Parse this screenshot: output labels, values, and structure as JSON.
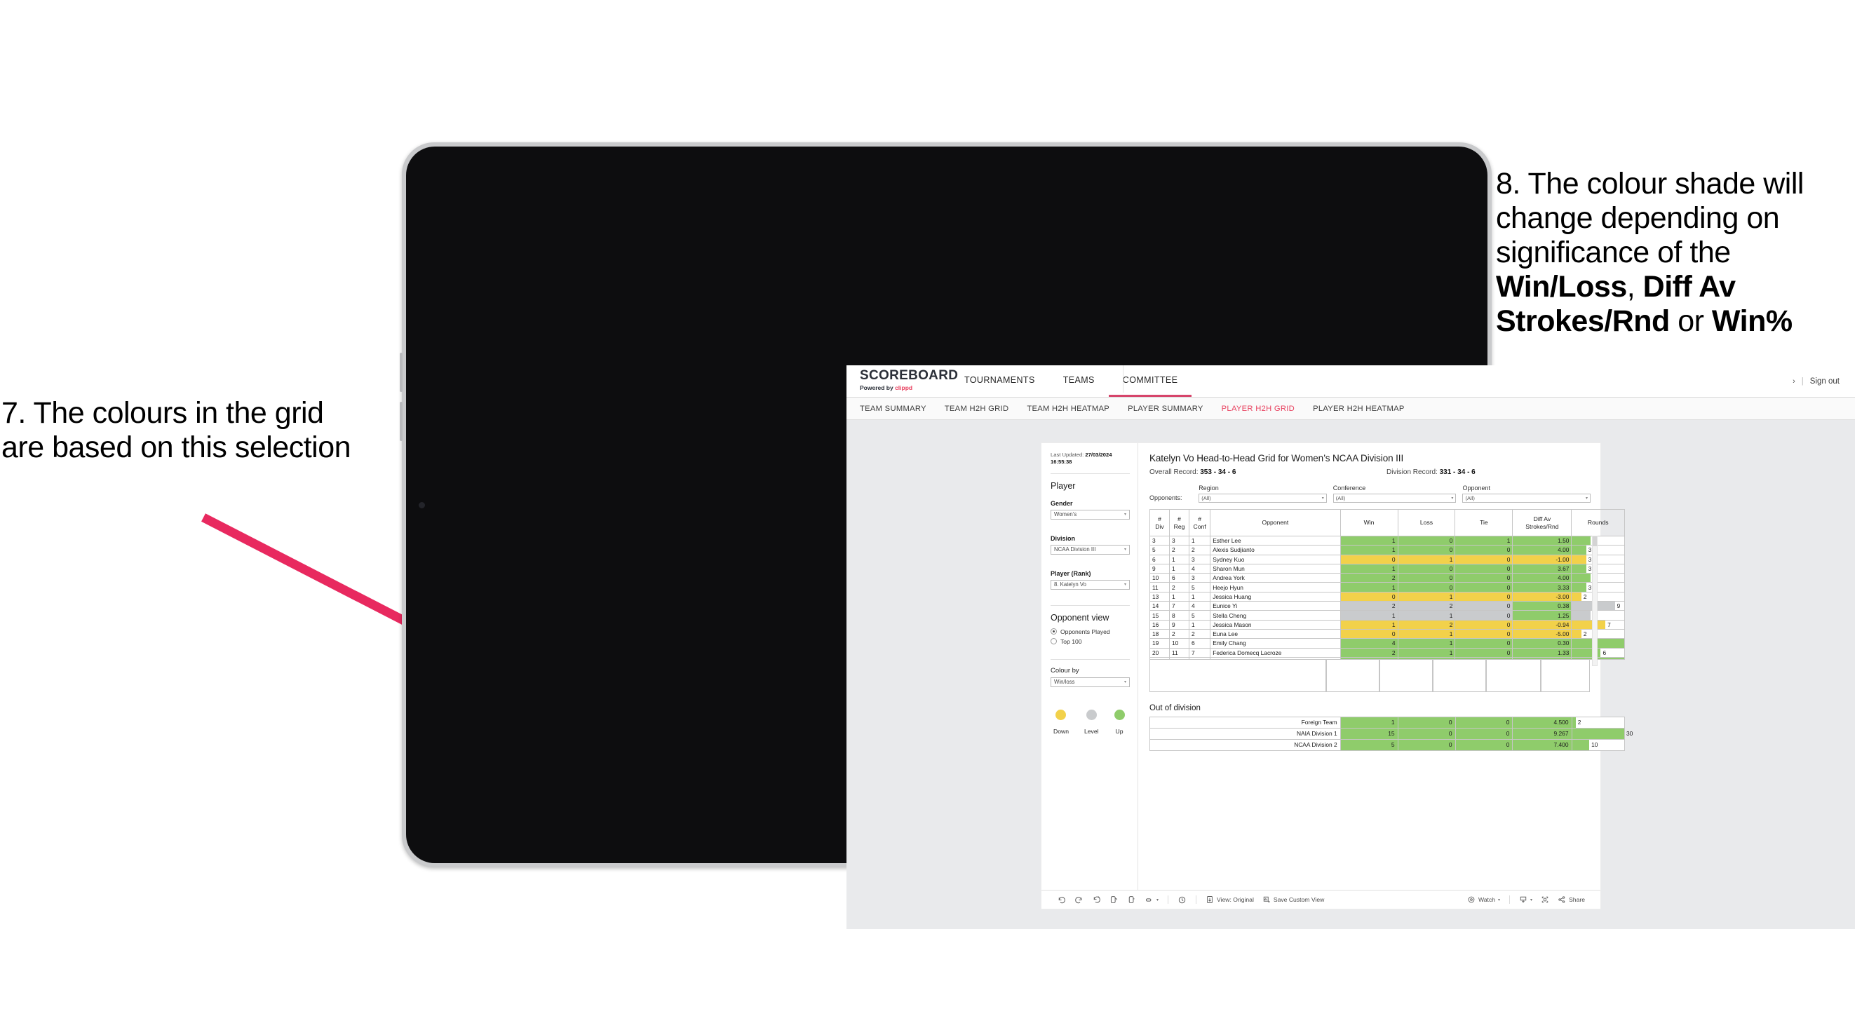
{
  "annotations": {
    "left": "7. The colours in the grid are based on this selection",
    "right_plain_1": "8. The colour shade will change depending on significance of the ",
    "right_bold_1": "Win/Loss",
    "right_sep_1": ", ",
    "right_bold_2": "Diff Av Strokes/Rnd",
    "right_plain_2": " or ",
    "right_bold_3": "Win%"
  },
  "app": {
    "logo": {
      "title": "SCOREBOARD",
      "powered_prefix": "Powered by ",
      "brand": "clippd"
    },
    "topnav": [
      {
        "label": "TOURNAMENTS",
        "active": false
      },
      {
        "label": "TEAMS",
        "active": false
      },
      {
        "label": "COMMITTEE",
        "active": true
      }
    ],
    "topnav_right": {
      "chevron": "›",
      "divider": "|",
      "signout": "Sign out"
    },
    "subnav": [
      {
        "label": "TEAM SUMMARY",
        "active": false
      },
      {
        "label": "TEAM H2H GRID",
        "active": false
      },
      {
        "label": "TEAM H2H HEATMAP",
        "active": false
      },
      {
        "label": "PLAYER SUMMARY",
        "active": false
      },
      {
        "label": "PLAYER H2H GRID",
        "active": true
      },
      {
        "label": "PLAYER H2H HEATMAP",
        "active": false
      }
    ]
  },
  "panel": {
    "last_updated_label": "Last Updated: ",
    "last_updated_value": "27/03/2024 16:55:38",
    "player_heading": "Player",
    "gender_label": "Gender",
    "gender_value": "Women’s",
    "division_label": "Division",
    "division_value": "NCAA Division III",
    "player_rank_label": "Player (Rank)",
    "player_rank_value": "8. Katelyn Vo",
    "opponent_view_heading": "Opponent view",
    "opponent_view_options": [
      {
        "label": "Opponents Played",
        "selected": true
      },
      {
        "label": "Top 100",
        "selected": false
      }
    ],
    "colour_by_label": "Colour by",
    "colour_by_value": "Win/loss",
    "legend": [
      {
        "label": "Down",
        "color": "#f2d14a"
      },
      {
        "label": "Level",
        "color": "#c9cbcd"
      },
      {
        "label": "Up",
        "color": "#8fcc6b"
      }
    ],
    "caret": "▾"
  },
  "view": {
    "title": "Katelyn Vo Head-to-Head Grid for Women’s NCAA Division III",
    "overall_record_label": "Overall Record: ",
    "overall_record_value": "353 -  34 - 6",
    "division_record_label": "Division Record: ",
    "division_record_value": "331 -  34 - 6",
    "opponents_label": "Opponents:",
    "filters": [
      {
        "label": "Region",
        "value": "(All)"
      },
      {
        "label": "Conference",
        "value": "(All)"
      },
      {
        "label": "Opponent",
        "value": "(All)"
      }
    ],
    "caret": "▾",
    "out_of_division_title": "Out of division"
  },
  "chart_data": {
    "type": "table",
    "title": "Katelyn Vo Head-to-Head Grid for Women’s NCAA Division III",
    "columns": [
      "# Div",
      "# Reg",
      "# Conf",
      "Opponent",
      "Win",
      "Loss",
      "Tie",
      "Diff Av Strokes/Rnd",
      "Rounds"
    ],
    "column_headers_multiline": [
      {
        "l1": "#",
        "l2": "Div"
      },
      {
        "l1": "#",
        "l2": "Reg"
      },
      {
        "l1": "#",
        "l2": "Conf"
      },
      {
        "l1": "Opponent",
        "l2": ""
      },
      {
        "l1": "Win",
        "l2": ""
      },
      {
        "l1": "Loss",
        "l2": ""
      },
      {
        "l1": "Tie",
        "l2": ""
      },
      {
        "l1": "Diff Av",
        "l2": "Strokes/Rnd"
      },
      {
        "l1": "Rounds",
        "l2": ""
      }
    ],
    "rounds_max": 11,
    "rows": [
      {
        "div": "3",
        "reg": "3",
        "conf": "1",
        "opponent": "Esther Lee",
        "win": "1",
        "loss": "0",
        "tie": "1",
        "diff": "1.50",
        "rounds": 4,
        "state": "up"
      },
      {
        "div": "5",
        "reg": "2",
        "conf": "2",
        "opponent": "Alexis Sudjianto",
        "win": "1",
        "loss": "0",
        "tie": "0",
        "diff": "4.00",
        "rounds": 3,
        "state": "up"
      },
      {
        "div": "6",
        "reg": "1",
        "conf": "3",
        "opponent": "Sydney Kuo",
        "win": "0",
        "loss": "1",
        "tie": "0",
        "diff": "-1.00",
        "rounds": 3,
        "state": "down"
      },
      {
        "div": "9",
        "reg": "1",
        "conf": "4",
        "opponent": "Sharon Mun",
        "win": "1",
        "loss": "0",
        "tie": "0",
        "diff": "3.67",
        "rounds": 3,
        "state": "up"
      },
      {
        "div": "10",
        "reg": "6",
        "conf": "3",
        "opponent": "Andrea York",
        "win": "2",
        "loss": "0",
        "tie": "0",
        "diff": "4.00",
        "rounds": 4,
        "state": "up"
      },
      {
        "div": "11",
        "reg": "2",
        "conf": "5",
        "opponent": "Heejo Hyun",
        "win": "1",
        "loss": "0",
        "tie": "0",
        "diff": "3.33",
        "rounds": 3,
        "state": "up"
      },
      {
        "div": "13",
        "reg": "1",
        "conf": "1",
        "opponent": "Jessica Huang",
        "win": "0",
        "loss": "1",
        "tie": "0",
        "diff": "-3.00",
        "rounds": 2,
        "state": "down"
      },
      {
        "div": "14",
        "reg": "7",
        "conf": "4",
        "opponent": "Eunice Yi",
        "win": "2",
        "loss": "2",
        "tie": "0",
        "diff": "0.38",
        "rounds": 9,
        "state": "level",
        "diff_state": "up"
      },
      {
        "div": "15",
        "reg": "8",
        "conf": "5",
        "opponent": "Stella Cheng",
        "win": "1",
        "loss": "1",
        "tie": "0",
        "diff": "1.25",
        "rounds": 4,
        "state": "level",
        "diff_state": "up"
      },
      {
        "div": "16",
        "reg": "9",
        "conf": "1",
        "opponent": "Jessica Mason",
        "win": "1",
        "loss": "2",
        "tie": "0",
        "diff": "-0.94",
        "rounds": 7,
        "state": "down"
      },
      {
        "div": "18",
        "reg": "2",
        "conf": "2",
        "opponent": "Euna Lee",
        "win": "0",
        "loss": "1",
        "tie": "0",
        "diff": "-5.00",
        "rounds": 2,
        "state": "down"
      },
      {
        "div": "19",
        "reg": "10",
        "conf": "6",
        "opponent": "Emily Chang",
        "win": "4",
        "loss": "1",
        "tie": "0",
        "diff": "0.30",
        "rounds": 11,
        "state": "up"
      },
      {
        "div": "20",
        "reg": "11",
        "conf": "7",
        "opponent": "Federica Domecq Lacroze",
        "win": "2",
        "loss": "1",
        "tie": "0",
        "diff": "1.33",
        "rounds": 6,
        "state": "up"
      }
    ],
    "out_of_division": {
      "rounds_max": 30,
      "rows": [
        {
          "name": "Foreign Team",
          "win": "1",
          "loss": "0",
          "tie": "0",
          "diff": "4.500",
          "rounds": 2,
          "state": "up"
        },
        {
          "name": "NAIA Division 1",
          "win": "15",
          "loss": "0",
          "tie": "0",
          "diff": "9.267",
          "rounds": 30,
          "state": "up"
        },
        {
          "name": "NCAA Division 2",
          "win": "5",
          "loss": "0",
          "tie": "0",
          "diff": "7.400",
          "rounds": 10,
          "state": "up"
        }
      ]
    }
  },
  "toolbar": {
    "view_label": "View: Original",
    "save_label": "Save Custom View",
    "watch_label": "Watch",
    "share_label": "Share",
    "caret": "▾"
  }
}
